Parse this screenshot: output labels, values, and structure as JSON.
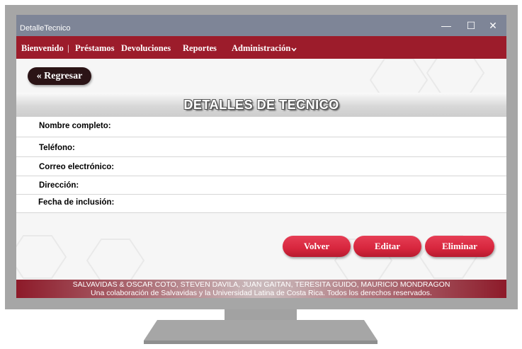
{
  "window": {
    "title": "DetalleTecnico",
    "minimize_glyph": "—",
    "maximize_glyph": "☐",
    "close_glyph": "✕"
  },
  "menu": {
    "items": [
      {
        "label": "Bienvenido"
      },
      {
        "label": "Préstamos"
      },
      {
        "label": "Devoluciones"
      },
      {
        "label": "Reportes"
      },
      {
        "label": "Administración"
      }
    ],
    "separator": "|"
  },
  "back_button": {
    "label": "« Regresar"
  },
  "page_title": "DETALLES DE TECNICO",
  "fields": [
    {
      "label": "Nombre completo:",
      "value": ""
    },
    {
      "label": "Teléfono:",
      "value": ""
    },
    {
      "label": "Correo electrónico:",
      "value": ""
    },
    {
      "label": "Dirección:",
      "value": ""
    },
    {
      "label": "Fecha de inclusión:",
      "value": ""
    }
  ],
  "actions": {
    "back": "Volver",
    "edit": "Editar",
    "delete": "Eliminar"
  },
  "footer": {
    "line1": "SALVAVIDAS & OSCAR COTO, STEVEN DAVILA, JUAN GAITAN, TERESITA GUIDO, MAURICIO MONDRAGON",
    "line2": "Una colaboración de Salvavidas y la Universidad Latina de Costa Rica. Todos los derechos reservados."
  },
  "colors": {
    "menubar": "#9c1c2b",
    "titlebar": "#7e8597",
    "action_button": "#d7263d",
    "back_button": "#2b1416"
  }
}
